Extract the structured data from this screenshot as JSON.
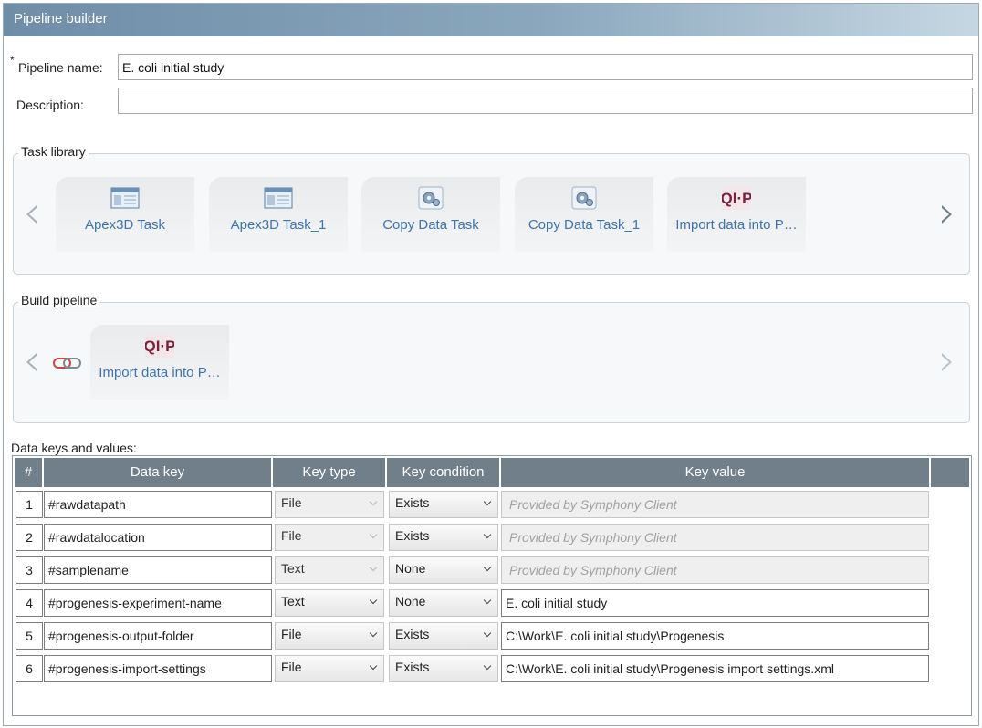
{
  "window": {
    "title": "Pipeline builder"
  },
  "form": {
    "required_mark": "*",
    "pipeline_name_label": "Pipeline name:",
    "pipeline_name_value": "E. coli initial study",
    "description_label": "Description:",
    "description_value": ""
  },
  "task_library": {
    "legend": "Task library",
    "tiles": [
      {
        "label": "Apex3D Task",
        "icon": "window-icon"
      },
      {
        "label": "Apex3D Task_1",
        "icon": "window-icon"
      },
      {
        "label": "Copy Data Task",
        "icon": "gear-icon"
      },
      {
        "label": "Copy Data Task_1",
        "icon": "gear-icon"
      },
      {
        "label": "Import data into P…",
        "icon": "qip-logo-icon"
      }
    ]
  },
  "build_pipeline": {
    "legend": "Build pipeline",
    "tiles": [
      {
        "label": "Import data into P…",
        "icon": "qip-logo-icon"
      }
    ]
  },
  "data_table": {
    "caption": "Data keys and values:",
    "headers": [
      "#",
      "Data key",
      "Key type",
      "Key condition",
      "Key value"
    ],
    "rows": [
      {
        "num": "1",
        "key": "#rawdatapath",
        "type": "File",
        "condition": "Exists",
        "value": "Provided by Symphony Client",
        "locked": true
      },
      {
        "num": "2",
        "key": "#rawdatalocation",
        "type": "File",
        "condition": "Exists",
        "value": "Provided by Symphony Client",
        "locked": true
      },
      {
        "num": "3",
        "key": "#samplename",
        "type": "Text",
        "condition": "None",
        "value": "Provided by Symphony Client",
        "locked": true
      },
      {
        "num": "4",
        "key": "#progenesis-experiment-name",
        "type": "Text",
        "condition": "None",
        "value": "E. coli initial study",
        "locked": false
      },
      {
        "num": "5",
        "key": "#progenesis-output-folder",
        "type": "File",
        "condition": "Exists",
        "value": "C:\\Work\\E. coli initial study\\Progenesis",
        "locked": false
      },
      {
        "num": "6",
        "key": "#progenesis-import-settings",
        "type": "File",
        "condition": "Exists",
        "value": "C:\\Work\\E. coli initial study\\Progenesis import settings.xml",
        "locked": false
      }
    ]
  },
  "colors": {
    "header_bg": "#707f8a",
    "link_blue": "#3d74b0",
    "qip_logo": "#7b1f3b"
  }
}
